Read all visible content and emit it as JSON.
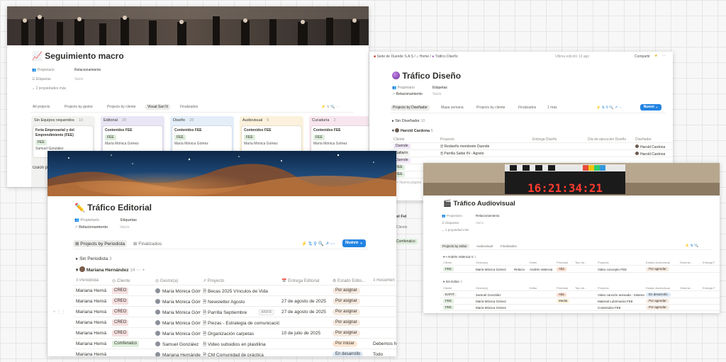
{
  "macro": {
    "title": "Seguimiento macro",
    "emoji": "📈",
    "props": [
      {
        "label": "Propietario",
        "value": "Relacionamiento"
      },
      {
        "label": "Etiquetas",
        "value": "Vacío"
      }
    ],
    "more": "2 propiedades más",
    "tabs": [
      "All projects",
      "Projects by gestor",
      "Projects by cliente",
      "Visual Sari N",
      "Finalizados"
    ],
    "columns": [
      {
        "name": "Sin Equipos requeridos",
        "count": "10",
        "color": "#f1f1ef",
        "card": "Feria Empresarial y del Emprendimiento (FEE)",
        "tag": "FEE",
        "person": "Samuel González"
      },
      {
        "name": "Editorial",
        "count": "29",
        "color": "#e9e5f5",
        "card": "Contenidos FEE",
        "tag": "FEE",
        "person": "María Mónica Gómez"
      },
      {
        "name": "Diseño",
        "count": "28",
        "color": "#e3eef9",
        "card": "Contenidos FEE",
        "tag": "FEE",
        "person": "María Mónica Gómez"
      },
      {
        "name": "Audiovisual",
        "count": "9",
        "color": "#fbf1dc",
        "card": "Contenidos FEE",
        "tag": "FEE",
        "person": "María Mónica Gómez"
      },
      {
        "name": "Curaduría",
        "count": "2",
        "color": "#f8e6ee",
        "card": "Contenidos FEE",
        "tag": "FEE",
        "person": "María Mónica Gómez"
      }
    ],
    "cut_text": "Guion p"
  },
  "diseno": {
    "breadcrumb": [
      "Sede de Duende S.A.S",
      "Home",
      "Tráfico Diseño"
    ],
    "edited": "Última edición 13 ago",
    "share": "Compartir",
    "title": "Tráfico Diseño",
    "props": [
      {
        "label": "Propietario",
        "value": "Etiquetas"
      },
      {
        "label": "Relacionamiento",
        "value": "Vacío"
      }
    ],
    "tabs": [
      "Projects by Diseñador",
      "Mapa semana",
      "Projects by cliente",
      "Finalizados",
      "1 más"
    ],
    "new_label": "Nuevo",
    "group1": "Sin Diseñador",
    "group1_count": "10",
    "group2": "Harold Cardona",
    "group2_count": "5",
    "headers": [
      "Cliente",
      "Proyecto",
      "Entrega Diseño",
      "Día de ejecución Diseño",
      "Diseñador"
    ],
    "rows": [
      {
        "cliente": "Duende",
        "proyecto": "Rediseño membrete Duende",
        "disenador": "Harold Cardona"
      },
      {
        "cliente": "Saltarín",
        "proyecto": "Parrilla Saltar IN - Agosto",
        "disenador": "Harold Cardona"
      },
      {
        "cliente": "Duende",
        "proyecto": "",
        "disenador": ""
      },
      {
        "cliente": "FEE",
        "proyecto": "",
        "disenador": ""
      },
      {
        "cliente": "FEE",
        "proyecto": "",
        "disenador": ""
      }
    ],
    "new_page": "Nueva página",
    "group3": "Daniel Fel",
    "extra_cliente": "Cliente",
    "extra_tag": "Comfenalco"
  },
  "audiovisual": {
    "title": "Tráfico Audiovisual",
    "clapper": "16:21:34:21",
    "props": [
      {
        "label": "Propietario",
        "value": "Relacionamiento"
      },
      {
        "label": "Etiquetas",
        "value": "Vacío"
      }
    ],
    "more": "1 propiedad más",
    "tabs": [
      "Projects by editor",
      "Audiovisual",
      "Finalizados"
    ],
    "group1": "Andrés Valencia V",
    "group1_count": "1",
    "headers1": [
      "Cliente",
      "Gestor(a)",
      "Editor",
      "Prioridad",
      "Tipo de...",
      "Proyecto",
      "Estado Audiovisual",
      "Dimensi...",
      "Entrega F"
    ],
    "row1": {
      "cliente": "FEE",
      "gestor": "María Mónica Gómez",
      "rel": "Relacio",
      "editor": "Andrés Valencia",
      "prio": "Alta",
      "proyecto": "Video concepto FEE",
      "estado": "Por agendar"
    },
    "group2": "Sin Editor",
    "group2_count": "3",
    "rows2": [
      {
        "cliente": "EAFIT",
        "gestor": "Samuel González",
        "prio": "Alta",
        "proyecto": "Video canción animada - Sistema",
        "estado": "En desarrollo"
      },
      {
        "cliente": "FEE",
        "gestor": "María Mónica Gómez",
        "prio": "Media",
        "proyecto": "Material Lubrimanía FEE",
        "estado": "Por agendar"
      },
      {
        "cliente": "FEE",
        "gestor": "María Mónica Gómez",
        "prio": "",
        "proyecto": "Contenidos FEE",
        "estado": "Por agendar"
      }
    ]
  },
  "editorial": {
    "title": "Tráfico Editorial",
    "emoji": "✏️",
    "props": [
      {
        "label": "Propietario",
        "value": "Etiquetas"
      },
      {
        "label": "Relacionamiento",
        "value": "Vacío"
      }
    ],
    "tabs": [
      "Projects by Periodista",
      "Finalizados"
    ],
    "new_label": "Nuevo",
    "group1": "Sin Periodista",
    "group1_count": "3",
    "group2": "Mariana Hernández",
    "group2_count": "14",
    "headers": [
      "Periodista",
      "Cliente",
      "Gestor(a)",
      "Proyecto",
      "Entrega Editorial",
      "Estado Edito...",
      "Resumen"
    ],
    "open_label": "ABRIR",
    "rows": [
      {
        "periodista": "Mariana Herná",
        "cliente": "CREO",
        "cc": "#f5e0e0",
        "gestor": "María Mónica Gómez",
        "proyecto": "Becas 2025 Vínculos de Vida",
        "entrega": "",
        "estado": "Por asignar",
        "ec": "#f5e9df",
        "resumen": ""
      },
      {
        "periodista": "Mariana Herná",
        "cliente": "CREO",
        "cc": "#f5e0e0",
        "gestor": "María Mónica Gómez",
        "proyecto": "Newsletter Agosto",
        "entrega": "27 de agosto de 2025",
        "estado": "Por asignar",
        "ec": "#f5e9df",
        "resumen": ""
      },
      {
        "periodista": "Mariana Herná",
        "cliente": "CREO",
        "cc": "#f5e0e0",
        "gestor": "María Mónica Gómez",
        "proyecto": "Parrilla Septiembre",
        "entrega": "27 de agosto de 2025",
        "estado": "Por asignar",
        "ec": "#f5e9df",
        "resumen": ""
      },
      {
        "periodista": "Mariana Herná",
        "cliente": "CREO",
        "cc": "#f5e0e0",
        "gestor": "María Mónica Gómez",
        "proyecto": "Piezas - Estrategia de comunicación e",
        "entrega": "",
        "estado": "Por asignar",
        "ec": "#f5e9df",
        "resumen": ""
      },
      {
        "periodista": "Mariana Herná",
        "cliente": "CREO",
        "cc": "#f5e0e0",
        "gestor": "María Mónica Gómez",
        "proyecto": "Organización carpetas",
        "entrega": "10 de julio de 2025",
        "estado": "Por asignar",
        "ec": "#f5e9df",
        "resumen": ""
      },
      {
        "periodista": "Mariana Herná",
        "cliente": "Comfenalco",
        "cc": "#dfeedd",
        "gestor": "Samuel González",
        "proyecto": "Video subsidios en plastilina",
        "entrega": "",
        "estado": "Por iniciar",
        "ec": "#fbe7d3",
        "resumen": "Debemos hac"
      },
      {
        "periodista": "Mariana Herná",
        "cliente": "",
        "cc": "#fff",
        "gestor": "Mariana Hernández",
        "proyecto": "CM Comunidad de práctica",
        "entrega": "",
        "estado": "En desarrollo",
        "ec": "#dde9f7",
        "resumen": "Todo"
      }
    ]
  }
}
